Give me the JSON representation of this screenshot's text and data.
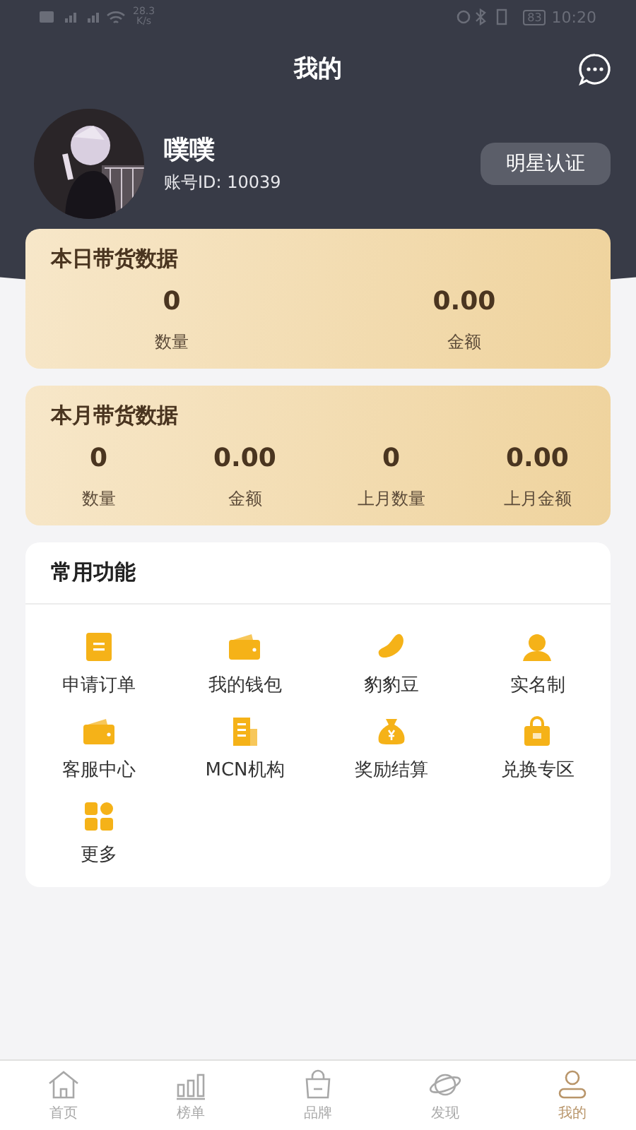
{
  "status_bar": {
    "speed": "28.3",
    "speed_unit": "K/s",
    "battery": "83",
    "time": "10:20"
  },
  "header": {
    "title": "我的"
  },
  "profile": {
    "name": "噗噗",
    "account": "账号ID: 10039",
    "button": "明星认证"
  },
  "today": {
    "title": "本日带货数据",
    "stats": [
      {
        "value": "0",
        "label": "数量"
      },
      {
        "value": "0.00",
        "label": "金额"
      }
    ]
  },
  "month": {
    "title": "本月带货数据",
    "stats": [
      {
        "value": "0",
        "label": "数量"
      },
      {
        "value": "0.00",
        "label": "金额"
      },
      {
        "value": "0",
        "label": "上月数量"
      },
      {
        "value": "0.00",
        "label": "上月金额"
      }
    ]
  },
  "functions": {
    "title": "常用功能",
    "items": [
      {
        "label": "申请订单",
        "kind": "clipboard"
      },
      {
        "label": "我的钱包",
        "kind": "wallet"
      },
      {
        "label": "豹豹豆",
        "kind": "bean"
      },
      {
        "label": "实名制",
        "kind": "person"
      },
      {
        "label": "客服中心",
        "kind": "wallet"
      },
      {
        "label": "MCN机构",
        "kind": "building"
      },
      {
        "label": "奖励结算",
        "kind": "moneybag"
      },
      {
        "label": "兑换专区",
        "kind": "bag"
      },
      {
        "label": "更多",
        "kind": "grid"
      }
    ]
  },
  "tab_bar": [
    {
      "label": "首页",
      "kind": "home",
      "selected": false
    },
    {
      "label": "榜单",
      "kind": "chart",
      "selected": false
    },
    {
      "label": "品牌",
      "kind": "bag",
      "selected": false
    },
    {
      "label": "发现",
      "kind": "planet",
      "selected": false
    },
    {
      "label": "我的",
      "kind": "user",
      "selected": true
    }
  ]
}
